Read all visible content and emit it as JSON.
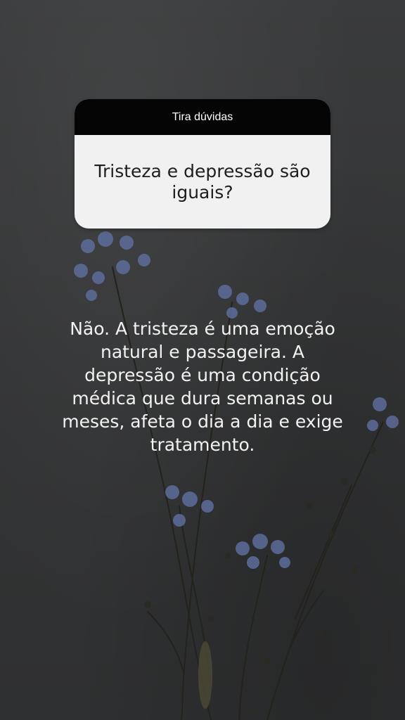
{
  "question_box": {
    "header_label": "Tira dúvidas",
    "question": "Tristeza e depressão são iguais?"
  },
  "answer": {
    "text": "Não. A tristeza é uma emoção natural e passageira. A depressão é uma condição médica que dura semanas ou meses, afeta o dia a dia e exige tratamento."
  },
  "colors": {
    "background": "#343536",
    "card_header": "#050505",
    "card_body": "#f1f1f1",
    "answer_text": "#f2f2f2",
    "flower_blue": "#5d6c9a"
  }
}
